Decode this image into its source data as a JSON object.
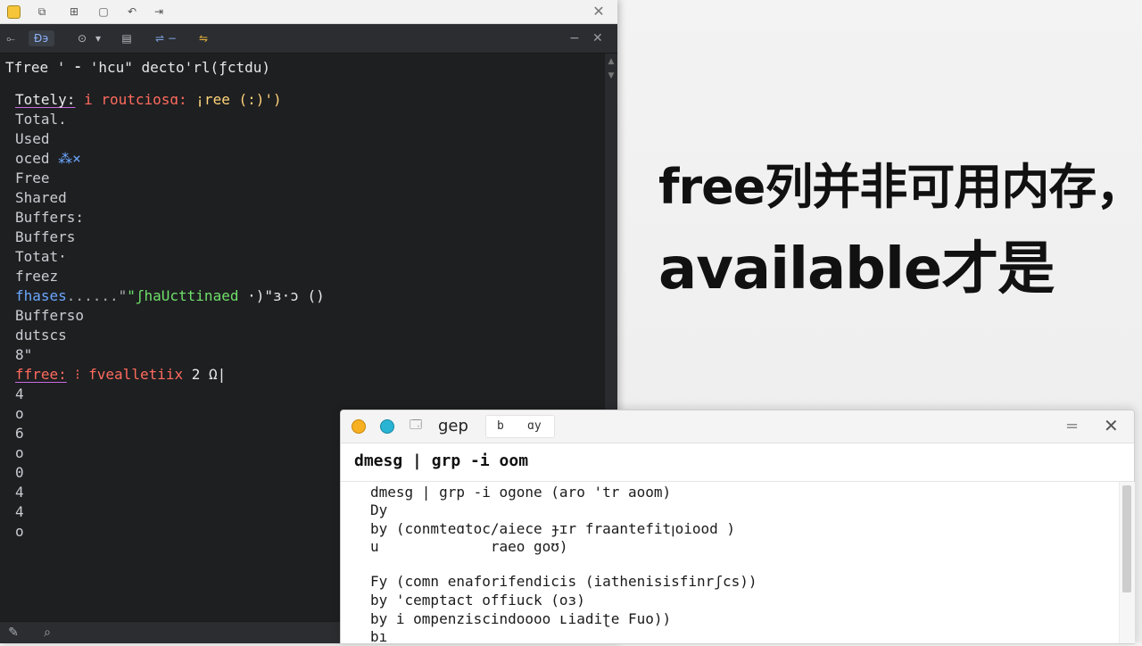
{
  "terminal": {
    "titlebar": {
      "icons": [
        "app-icon",
        "copy-icon",
        "layers-icon",
        "window-icon",
        "back-icon",
        "forward-icon"
      ],
      "close_label": "✕"
    },
    "toolbar": {
      "items": [
        "⟜",
        "Đ϶",
        "⊙",
        "▾",
        "▤",
        "⇌ −",
        "⇋"
      ],
      "right_min": "−",
      "right_close": "✕"
    },
    "top_line": "Tfree ' ⁃ 'hcu\" decto'rl(ƒctdu)",
    "lines": [
      {
        "a": "Totely:",
        "b": " i routciosɑ: ",
        "c": "¡ree (:)')",
        "style": "highlight"
      },
      {
        "a": "Total.",
        "style": "plain"
      },
      {
        "a": "Used",
        "style": "plain"
      },
      {
        "a": "oced ",
        "b": "⁂×",
        "style": "blue-tail"
      },
      {
        "a": "Free",
        "style": "plain"
      },
      {
        "a": "Shared",
        "style": "plain"
      },
      {
        "a": "Buffers:",
        "style": "plain"
      },
      {
        "a": "Buffers",
        "style": "plain"
      },
      {
        "a": "Totat·",
        "style": "plain"
      },
      {
        "a": "freez",
        "style": "plain"
      },
      {
        "a": "fhases",
        "b": "......\"",
        "c": "\"ʃhaUcttinaed",
        "d": " ·)\"ɜ·ɔ ()",
        "style": "green"
      },
      {
        "a": "Bufferso",
        "style": "plain"
      },
      {
        "a": "dutscs",
        "style": "plain"
      },
      {
        "a": "8\"",
        "style": "plain"
      },
      {
        "a": "ffree:",
        "b": " ⁝ fvealletiix",
        "c": " 2 Ω|",
        "style": "red"
      },
      {
        "a": "4",
        "style": "plain"
      },
      {
        "a": "o",
        "style": "plain"
      },
      {
        "a": "6",
        "style": "plain"
      },
      {
        "a": "o",
        "style": "plain"
      },
      {
        "a": "0",
        "style": "plain"
      },
      {
        "a": "4",
        "style": "plain"
      },
      {
        "a": "4",
        "style": "plain"
      },
      {
        "a": "o",
        "style": "plain"
      }
    ],
    "status_icons": [
      "edit-icon",
      "search-icon"
    ]
  },
  "caption": {
    "line1": "free列并非可用内存，",
    "line2": "available才是"
  },
  "grep_window": {
    "title": "gep",
    "tab_left": "b",
    "tab_right": "ɑy",
    "min_label": "=",
    "close_label": "✕",
    "command": "dmesg | grp -i oom",
    "output": [
      "dmesg | grp -i ogone (aro 'tr aoom)",
      "Dy",
      "by (conmteɑtoc/aiece ɟɪr fraantefitꞁoiood )",
      "u             raeo goʊ)",
      "",
      "Fy (comn enaforifendicis (iathenisisfinrʃcs))",
      "by 'cemptact offiuck (oɜ)",
      "by i ompenziscindoooo ʟiadiʈe Fuo))",
      "bı"
    ]
  }
}
